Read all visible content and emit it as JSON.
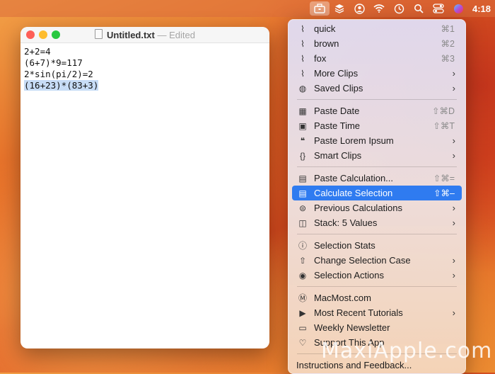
{
  "menubar": {
    "icons": [
      "clipboard-toolbox-icon",
      "layers-icon",
      "user-circle-icon",
      "wifi-icon",
      "time-machine-icon",
      "search-icon",
      "control-center-icon",
      "siri-icon"
    ],
    "clock": "4:18"
  },
  "window": {
    "title": "Untitled.txt",
    "separator": "—",
    "status": "Edited",
    "lines": [
      "2+2=4",
      "(6+7)*9=117",
      "2*sin(pi/2)=2",
      "(16+23)*(83+3)"
    ]
  },
  "menu": {
    "items": [
      {
        "label": "quick",
        "shortcut": "⌘1",
        "icon": "paperclip-icon"
      },
      {
        "label": "brown",
        "shortcut": "⌘2",
        "icon": "paperclip-icon"
      },
      {
        "label": "fox",
        "shortcut": "⌘3",
        "icon": "paperclip-icon"
      },
      {
        "label": "More Clips",
        "icon": "paperclip-icon",
        "submenu": true
      },
      {
        "label": "Saved Clips",
        "icon": "saved-clip-icon",
        "submenu": true
      },
      {
        "label": "Paste Date",
        "shortcut": "⇧⌘D",
        "icon": "calendar-icon"
      },
      {
        "label": "Paste Time",
        "shortcut": "⇧⌘T",
        "icon": "calendar-clock-icon"
      },
      {
        "label": "Paste Lorem Ipsum",
        "icon": "quote-icon",
        "submenu": true
      },
      {
        "label": "Smart Clips",
        "icon": "braces-icon",
        "submenu": true
      },
      {
        "label": "Paste Calculation...",
        "shortcut": "⇧⌘=",
        "icon": "calculator-icon"
      },
      {
        "label": "Calculate Selection",
        "shortcut": "⇧⌘–",
        "icon": "calculator-icon",
        "highlighted": true
      },
      {
        "label": "Previous Calculations",
        "icon": "equals-circle-icon",
        "submenu": true
      },
      {
        "label": "Stack: 5 Values",
        "icon": "stack-icon",
        "submenu": true
      },
      {
        "label": "Selection Stats",
        "icon": "info-icon"
      },
      {
        "label": "Change Selection Case",
        "icon": "case-arrow-icon",
        "submenu": true
      },
      {
        "label": "Selection Actions",
        "icon": "eye-gear-icon",
        "submenu": true
      },
      {
        "label": "MacMost.com",
        "icon": "m-logo-icon"
      },
      {
        "label": "Most Recent Tutorials",
        "icon": "play-icon",
        "submenu": true
      },
      {
        "label": "Weekly Newsletter",
        "icon": "newsletter-icon"
      },
      {
        "label": "Support This App",
        "icon": "heart-icon"
      },
      {
        "label": "Instructions and Feedback...",
        "icon": ""
      }
    ]
  },
  "watermark": "MaxiApple.com"
}
